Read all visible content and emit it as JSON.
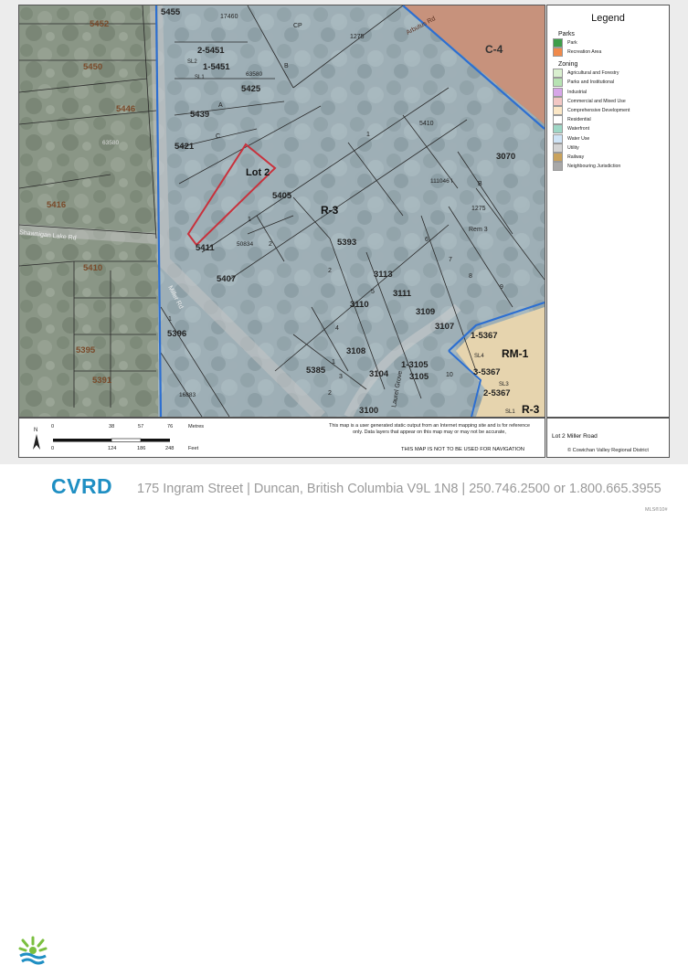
{
  "map": {
    "zone_labels": {
      "r3": "R-3",
      "c4": "C-4",
      "rm1": "RM-1",
      "r3_corner": "R-3"
    },
    "subject_lot": "Lot 2",
    "roads": {
      "miller": "Miller Rd",
      "shawnigan": "Shawnigan Lake Rd",
      "auger": "Arbutus Rd",
      "laurel": "Laurel Grove"
    },
    "parcel_numbers": {
      "p5455": "5455",
      "p17460": "17460",
      "p1275a": "1275",
      "p5452": "5452",
      "p5450": "5450",
      "p2_5451": "2-5451",
      "p1_5451": "1-5451",
      "sl2": "SL2",
      "sl1": "SL1",
      "p63580a": "63580",
      "p5425": "5425",
      "p5439": "5439",
      "p5446": "5446",
      "p63580b": "63580",
      "p5421": "5421",
      "p5410a": "5410",
      "p3070": "3070",
      "p5416": "5416",
      "p5405": "5405",
      "p111046": "111046 I",
      "p1275b": "1275",
      "rem3": "Rem 3",
      "p5411": "5411",
      "p50834": "50834",
      "p5393": "5393",
      "p5410b": "5410",
      "p5407": "5407",
      "p3113": "3113",
      "p3111": "3111",
      "p3110": "3110",
      "p3109": "3109",
      "p3107": "3107",
      "p1_5367": "1-5367",
      "p5396": "5396",
      "p5395": "5395",
      "p5391": "5391",
      "p3108": "3108",
      "p5385": "5385",
      "p3104": "3104",
      "p1_3105": "1-3105",
      "p3105": "3105",
      "p3_5367": "3-5367",
      "sl4": "SL4",
      "sl3": "SL3",
      "p2_5367": "2-5367",
      "p3100": "3100",
      "p16883": "16883",
      "cp": "CP",
      "a": "A",
      "b": "B",
      "c": "C",
      "b2": "B",
      "n1": "1",
      "n1b": "1",
      "n2": "2",
      "n2b": "2",
      "n5": "5",
      "n6": "6",
      "n7": "7",
      "n8": "8",
      "n9": "9",
      "n4": "4",
      "n3": "3",
      "n10": "10",
      "n2c": "2",
      "n1c": "1",
      "n1d": "1",
      "sl1b": "SL1"
    }
  },
  "legend": {
    "title": "Legend",
    "sections": [
      {
        "heading": "Parks",
        "items": [
          {
            "label": "Park",
            "color": "#3e9e4a"
          },
          {
            "label": "Recreation Area",
            "color": "#f08a4b"
          }
        ]
      },
      {
        "heading": "Zoning",
        "items": [
          {
            "label": "Agricultural and Forestry",
            "color": "#d9efcf"
          },
          {
            "label": "Parks and Institutional",
            "color": "#b7e3b3"
          },
          {
            "label": "Industrial",
            "color": "#d7a6e8"
          },
          {
            "label": "Commercial and Mixed Use",
            "color": "#f2c7c4"
          },
          {
            "label": "Comprehensive Development",
            "color": "#fbe7c6"
          },
          {
            "label": "Residential",
            "color": "#ffffff"
          },
          {
            "label": "Waterfront",
            "color": "#9fd7c6"
          },
          {
            "label": "Water Use",
            "color": "#cfe4f6"
          },
          {
            "label": "Utility",
            "color": "#d4d4d4"
          },
          {
            "label": "Railway",
            "color": "#c9a25c"
          },
          {
            "label": "Neighbouring Jurisdiction",
            "color": "#a8a8a8"
          }
        ]
      }
    ]
  },
  "scale": {
    "north": "N",
    "metres_ticks": [
      "0",
      "38",
      "57",
      "76"
    ],
    "metres_unit": "Metres",
    "feet_ticks": [
      "0",
      "124",
      "186",
      "248"
    ],
    "feet_unit": "Feet",
    "disclaimer": "This map is a user generated static output from an Internet mapping site and is for reference only. Data layers that appear on this map may or may not be accurate,",
    "not_for_navigation": "THIS MAP IS NOT TO BE USED FOR NAVIGATION"
  },
  "caption": {
    "title": "Lot 2 Miller Road",
    "credit": "© Cowichan Valley Regional District"
  },
  "footer": {
    "logo_text": "CVRD",
    "address": "175 Ingram Street  |  Duncan, British Columbia V9L 1N8  |  250.746.2500 or 1.800.665.3955",
    "mls": "MLS®10#"
  }
}
